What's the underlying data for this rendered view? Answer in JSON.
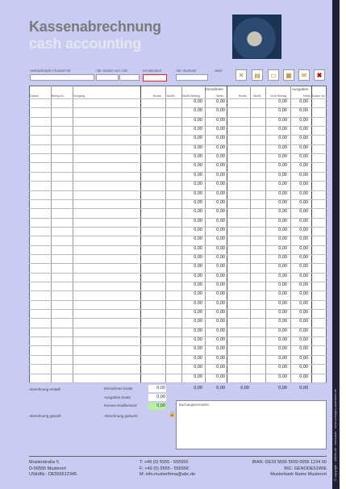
{
  "header": {
    "title": "Kassenabrechnung",
    "subtitle": "cash accounting"
  },
  "fields": {
    "verkaufsstelle": "Verkaufsstelle / Kassen-Nr",
    "abr_datum": "Abr.-Datum von / bis",
    "ka_bestand": "KA-Bestand",
    "abr_nummer": "Abr.-Nummer",
    "seite": "Seite"
  },
  "toolbar": {
    "icons": [
      "clear-form-icon",
      "document-icon",
      "folder-icon",
      "print-icon",
      "export-icon",
      "delete-icon"
    ]
  },
  "table": {
    "group_income": "Einnahmen",
    "group_expense": "Ausgaben",
    "columns": [
      "Datum",
      "Beleg-Nr.",
      "Vorgang",
      "Brutto",
      "MwSt.",
      "MwSt.Betrag",
      "Netto",
      "Brutto",
      "MwSt.",
      "VoSt Betrag",
      "Netto",
      "Kasse Ist"
    ],
    "zero": "0,00",
    "row_count": 31
  },
  "summary": {
    "abrechnung_erstellt": "Abrechnung erstellt",
    "abrechnung_geprueft": "Abrechnung geprüft",
    "abrechnung_gebucht": "Abrechnung gebucht",
    "einnahmen_brutto_label": "Einnahmen brutto",
    "einnahmen_brutto": "0,00",
    "ausgaben_brutto_label": "Ausgaben brutto",
    "ausgaben_brutto": "0,00",
    "kassen_endbestand_label": "Kassen-Endbestand",
    "kassen_endbestand": "0,00",
    "total_income_netto": "0,00",
    "total_income_mwst": "0,00",
    "total_expense_brutto": "0,00",
    "total_expense_vost": "0,00",
    "total_expense_netto": "0,00",
    "notes_label": "Buchungsvermerke"
  },
  "footer": {
    "street": "Musterstraße 5",
    "city": "D-56555 Musterort",
    "ustid": "UStIdNr.: DE555512345",
    "tel": "T: +49 (0) 5555 - 555555",
    "fax": "F: +49 (0) 5555 - 555556",
    "mail": "M: info.musterfirma@abc.de",
    "iban": "IBAN: DE33 5555 5500 0055 1234 00",
    "bic": "BIC: GENODE61WIE",
    "bank": "Musterbank Name Musterort"
  },
  "sidebar": {
    "text": "© copyright · a4kids.de · formulare · www.vorlagen-download.de"
  },
  "colors": {
    "background": "#c9ccf2",
    "sidebar": "#1e2034",
    "ka_border": "#e02020",
    "kassen_end_highlight": "#b9f0a0"
  }
}
